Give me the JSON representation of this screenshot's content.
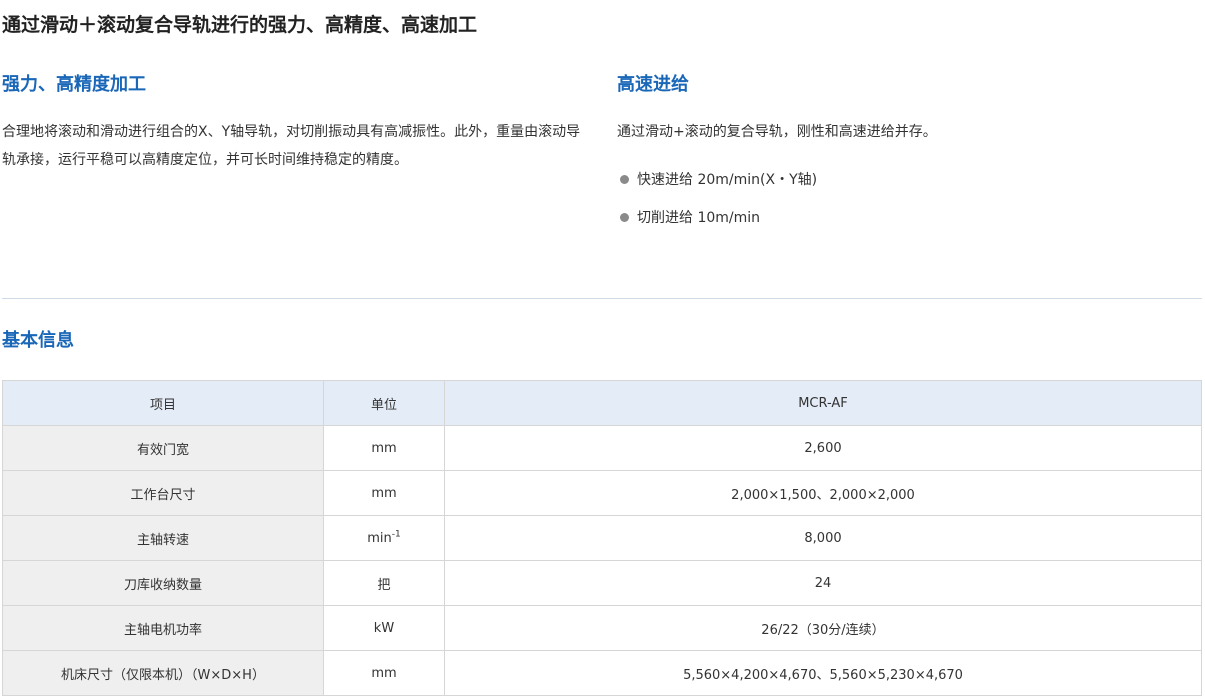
{
  "main_title": "通过滑动＋滚动复合导轨进行的强力、高精度、高速加工",
  "left_section": {
    "title": "强力、高精度加工",
    "text": "合理地将滚动和滑动进行组合的X、Y轴导轨，对切削振动具有高减振性。此外，重量由滚动导轨承接，运行平稳可以高精度定位，并可长时间维持稳定的精度。"
  },
  "right_section": {
    "title": "高速进给",
    "text": "通过滑动+滚动的复合导轨，刚性和高速进给并存。",
    "bullets": [
      "快速进给 20m/min(X・Y轴)",
      "切削进给 10m/min"
    ]
  },
  "info_title": "基本信息",
  "table": {
    "headers": [
      "项目",
      "单位",
      "MCR-AF"
    ],
    "rows": [
      {
        "item": "有效门宽",
        "unit": "mm",
        "value": "2,600"
      },
      {
        "item": "工作台尺寸",
        "unit": "mm",
        "value": "2,000×1,500、2,000×2,000"
      },
      {
        "item": "主轴转速",
        "unit": "min",
        "unit_sup": "-1",
        "value": "8,000"
      },
      {
        "item": "刀库收纳数量",
        "unit": "把",
        "value": "24"
      },
      {
        "item": "主轴电机功率",
        "unit": "kW",
        "value": "26/22（30分/连续）"
      },
      {
        "item": "机床尺寸（仅限本机）（W×D×H）",
        "unit": "mm",
        "value": "5,560×4,200×4,670、5,560×5,230×4,670"
      }
    ]
  },
  "colors": {
    "accent_blue": "#1a67b8",
    "header_bg": "#e4ecf7",
    "first_col_bg": "#efefef",
    "bullet_gray": "#8a8a8a"
  }
}
